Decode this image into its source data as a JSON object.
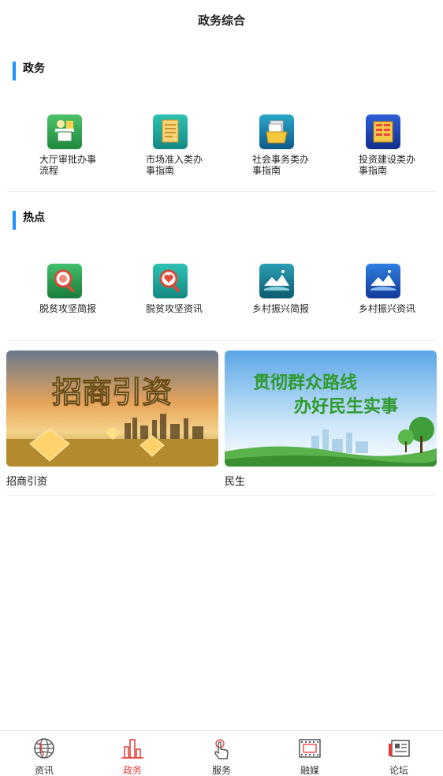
{
  "header": {
    "title": "政务综合"
  },
  "sections": [
    {
      "label": "政务",
      "items": [
        {
          "label": "大厅审批办事流程",
          "icon": "approval-person-icon"
        },
        {
          "label": "市场准入类办事指南",
          "icon": "document-list-icon"
        },
        {
          "label": "社会事务类办事指南",
          "icon": "folder-docs-icon"
        },
        {
          "label": "投资建设类办事指南",
          "icon": "ledger-book-icon"
        }
      ]
    },
    {
      "label": "热点",
      "items": [
        {
          "label": "脱贫攻坚简报",
          "icon": "magnifier-icon"
        },
        {
          "label": "脱贫攻坚资讯",
          "icon": "magnifier-heart-icon"
        },
        {
          "label": "乡村振兴简报",
          "icon": "village-house-icon"
        },
        {
          "label": "乡村振兴资讯",
          "icon": "village-house-blue-icon"
        }
      ]
    }
  ],
  "banners": [
    {
      "image_text": "招商引资",
      "caption": "招商引资"
    },
    {
      "image_text_line1": "贯彻群众路线",
      "image_text_line2": "办好民生实事",
      "caption": "民生"
    }
  ],
  "tabbar": {
    "items": [
      {
        "label": "资讯",
        "icon": "globe-icon",
        "active": false
      },
      {
        "label": "政务",
        "icon": "building-chart-icon",
        "active": true
      },
      {
        "label": "服务",
        "icon": "hand-tap-icon",
        "active": false
      },
      {
        "label": "融媒",
        "icon": "film-strip-icon",
        "active": false
      },
      {
        "label": "论坛",
        "icon": "newspaper-icon",
        "active": false
      }
    ]
  },
  "colors": {
    "accent": "#1e90ff",
    "active_tab": "#e53935"
  }
}
